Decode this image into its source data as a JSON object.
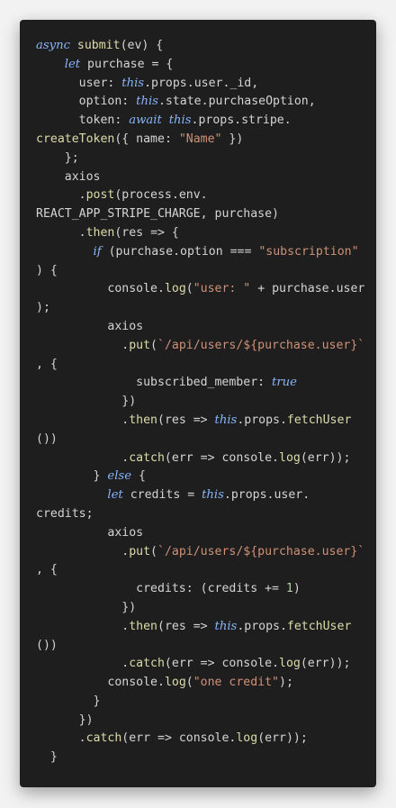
{
  "code_lines": [
    "async submit(ev) {",
    "    let purchase = {",
    "      user: this.props.user._id,",
    "      option: this.state.purchaseOption,",
    "      token: await this.props.stripe.",
    "createToken({ name: \"Name\" })",
    "    };",
    "    axios",
    "      .post(process.env.",
    "REACT_APP_STRIPE_CHARGE, purchase)",
    "      .then(res => {",
    "        if (purchase.option === \"subscription\"",
    ") {",
    "          console.log(\"user: \" + purchase.user",
    ");",
    "          axios",
    "            .put(`/api/users/${purchase.user}`",
    ", {",
    "              subscribed_member: true",
    "            })",
    "            .then(res => this.props.fetchUser",
    "())",
    "            .catch(err => console.log(err));",
    "        } else {",
    "          let credits = this.props.user.",
    "credits;",
    "          axios",
    "            .put(`/api/users/${purchase.user}`",
    ", {",
    "              credits: (credits += 1)",
    "            })",
    "            .then(res => this.props.fetchUser",
    "())",
    "            .catch(err => console.log(err));",
    "          console.log(\"one credit\");",
    "        }",
    "      })",
    "      .catch(err => console.log(err));",
    "  }"
  ],
  "colors": {
    "background": "#1e1e1e",
    "keyword": "#89b4fa",
    "string": "#ce9178",
    "function": "#dcdcaa",
    "property": "#9cdcfe",
    "text": "#d4d4d4"
  }
}
